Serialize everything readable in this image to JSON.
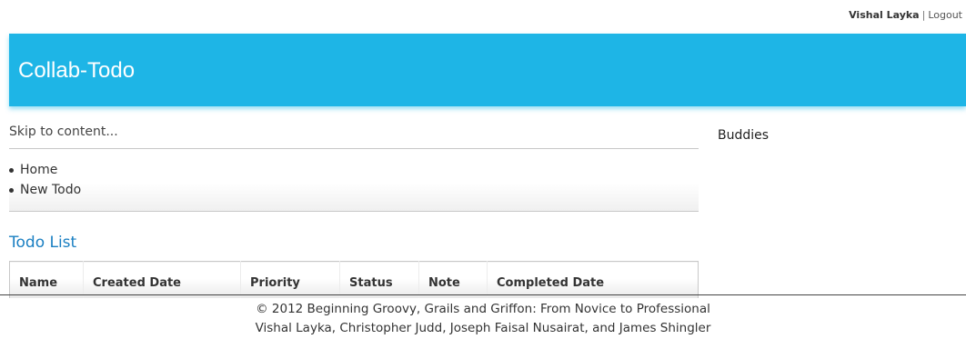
{
  "userbar": {
    "user_name": "Vishal Layka",
    "separator": "|",
    "logout_label": "Logout"
  },
  "header": {
    "app_title": "Collab-Todo",
    "banner_color": "#1eb5e6"
  },
  "skip_link": "Skip to content...",
  "nav": {
    "items": [
      {
        "label": "Home"
      },
      {
        "label": "New Todo"
      }
    ]
  },
  "main": {
    "section_title": "Todo List",
    "table": {
      "columns": [
        "Name",
        "Created Date",
        "Priority",
        "Status",
        "Note",
        "Completed Date"
      ],
      "rows": []
    }
  },
  "sidebar": {
    "title": "Buddies"
  },
  "footer": {
    "line1": "© 2012 Beginning Groovy, Grails and Griffon: From Novice to Professional",
    "line2": "Vishal Layka, Christopher Judd, Joseph Faisal Nusairat, and James Shingler"
  }
}
